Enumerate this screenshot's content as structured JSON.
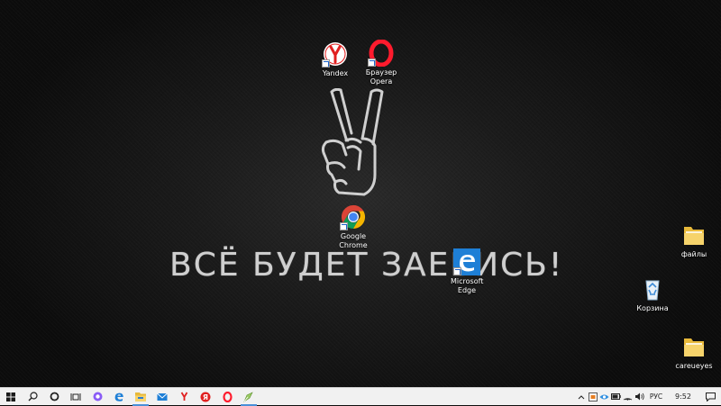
{
  "wallpaper": {
    "text": "ВСЁ БУДЕТ ЗАЕБИСЬ!",
    "background_color": "#141414",
    "art_color": "#cfcfcf"
  },
  "desktop_icons": [
    {
      "id": "yandex",
      "label": "Yandex",
      "icon": "yandex-browser-icon",
      "color": "#e02020",
      "shortcut": true
    },
    {
      "id": "opera",
      "label": "Браузер Opera",
      "icon": "opera-icon",
      "color": "#ff1b2d",
      "shortcut": true
    },
    {
      "id": "chrome",
      "label": "Google Chrome",
      "icon": "chrome-icon",
      "color": "#4285f4",
      "shortcut": true
    },
    {
      "id": "edge",
      "label": "Microsoft Edge",
      "icon": "edge-icon",
      "color": "#1e7fd6",
      "shortcut": true
    },
    {
      "id": "files",
      "label": "файлы",
      "icon": "folder-icon",
      "color": "#f2c94c",
      "shortcut": false
    },
    {
      "id": "recycle",
      "label": "Корзина",
      "icon": "recycle-bin-icon",
      "color": "#7ab0d8",
      "shortcut": false
    },
    {
      "id": "careueyes",
      "label": "careueyes",
      "icon": "folder-icon",
      "color": "#f2c94c",
      "shortcut": false
    }
  ],
  "taskbar": {
    "accent_color": "#4a90d9",
    "apps": [
      {
        "name": "start",
        "icon": "windows-logo-icon"
      },
      {
        "name": "search",
        "icon": "search-icon"
      },
      {
        "name": "cortana",
        "icon": "cortana-circle-icon"
      },
      {
        "name": "task-view",
        "icon": "task-view-icon"
      },
      {
        "name": "alice",
        "icon": "alice-voice-assistant-icon"
      },
      {
        "name": "edge",
        "icon": "edge-icon"
      },
      {
        "name": "file-explorer",
        "icon": "folder-icon"
      },
      {
        "name": "mail",
        "icon": "mail-icon"
      },
      {
        "name": "yandex-browser",
        "icon": "yandex-browser-icon"
      },
      {
        "name": "yandex",
        "icon": "yandex-icon"
      },
      {
        "name": "opera",
        "icon": "opera-icon"
      },
      {
        "name": "notepad",
        "icon": "notepad-icon"
      }
    ],
    "tray": {
      "language": "РУС",
      "time": "9:52",
      "icons": [
        "chevron-up-icon",
        "app-tray-icon",
        "eye-icon",
        "battery-icon",
        "wifi-icon",
        "volume-icon"
      ]
    }
  }
}
